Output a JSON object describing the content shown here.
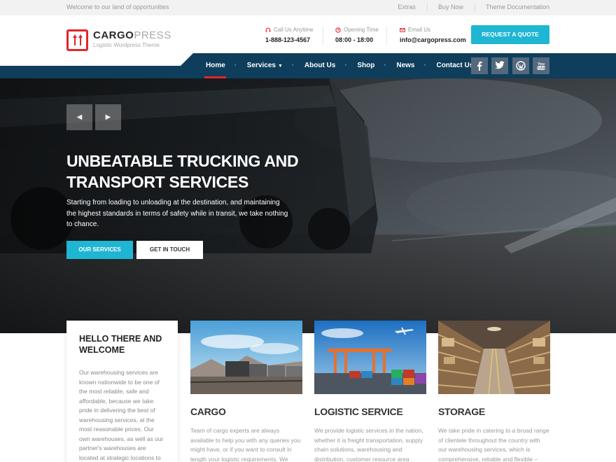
{
  "topbar": {
    "welcome": "Welcome to our land of opportunities",
    "links": [
      "Extras",
      "Buy Now",
      "Theme Documentation"
    ]
  },
  "logo": {
    "name_part1": "CARGO",
    "name_part2": "PRESS",
    "tagline": "Logistic Wordpress Theme"
  },
  "header_info": [
    {
      "icon": "headset-icon",
      "label": "Call Us Anytime",
      "value": "1-888-123-4567"
    },
    {
      "icon": "clock-icon",
      "label": "Opening Time",
      "value": "08:00 - 18:00"
    },
    {
      "icon": "envelope-icon",
      "label": "Email Us",
      "value": "info@cargopress.com"
    }
  ],
  "quote_button": "REQUEST A QUOTE",
  "nav": {
    "items": [
      "Home",
      "Services",
      "About Us",
      "Shop",
      "News",
      "Contact Us"
    ],
    "active": "Home",
    "social_icons": [
      "facebook-icon",
      "twitter-icon",
      "wordpress-icon",
      "youtube-icon"
    ]
  },
  "hero": {
    "title": "UNBEATABLE TRUCKING AND TRANSPORT SERVICES",
    "text": "Starting from loading to unloading at the destination, and maintaining the highest standards in terms of safety while in transit, we take nothing to chance.",
    "primary_button": "OUR SERVICES",
    "secondary_button": "GET IN TOUCH"
  },
  "welcome_box": {
    "title": "HELLO THERE AND WELCOME",
    "text": "Our warehousing services are known nationwide to be one of the most reliable, safe and affordable, because we take pride in delivering the best of warehousing services, at the most reasonable prices. Our own warehouses, as well as our partner's warehouses are located at strategic locations to"
  },
  "services": [
    {
      "title": "CARGO",
      "text": "Team of cargo experts are always available to help you with any queries you might have, or if you want to consult in length your logistic requirements. We"
    },
    {
      "title": "LOGISTIC SERVICE",
      "text": "We provide logistic services in the nation, whether it is freight transportation, supply chain solutions, warehousing and distribution, customer resource area"
    },
    {
      "title": "STORAGE",
      "text": "We take pride in catering to a broad range of clientele throughout the country with our warehousing services, which is comprehensive, reliable and flexible –"
    }
  ],
  "colors": {
    "accent": "#1fb6d3",
    "brand_red": "#e2262c",
    "nav_bg": "#0e3e5b"
  }
}
